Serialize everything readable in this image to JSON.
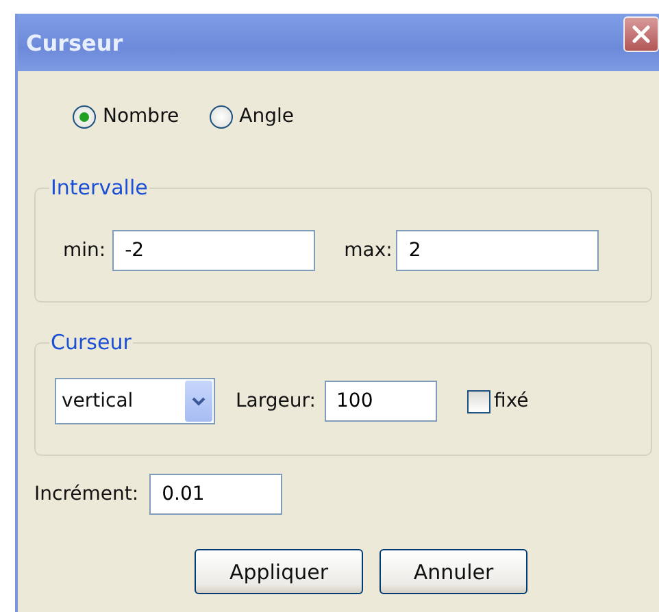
{
  "window": {
    "title": "Curseur"
  },
  "type_options": [
    {
      "label": "Nombre",
      "selected": true
    },
    {
      "label": "Angle",
      "selected": false
    }
  ],
  "intervalle": {
    "title": "Intervalle",
    "min_label": "min:",
    "min_value": "-2",
    "max_label": "max:",
    "max_value": "2"
  },
  "curseur": {
    "title": "Curseur",
    "orientation": "vertical",
    "width_label": "Largeur:",
    "width_value": "100",
    "fixed_label": "fixé",
    "fixed_checked": false
  },
  "increment": {
    "label": "Incrément:",
    "value": "0.01"
  },
  "buttons": [
    "Appliquer",
    "Annuler"
  ]
}
